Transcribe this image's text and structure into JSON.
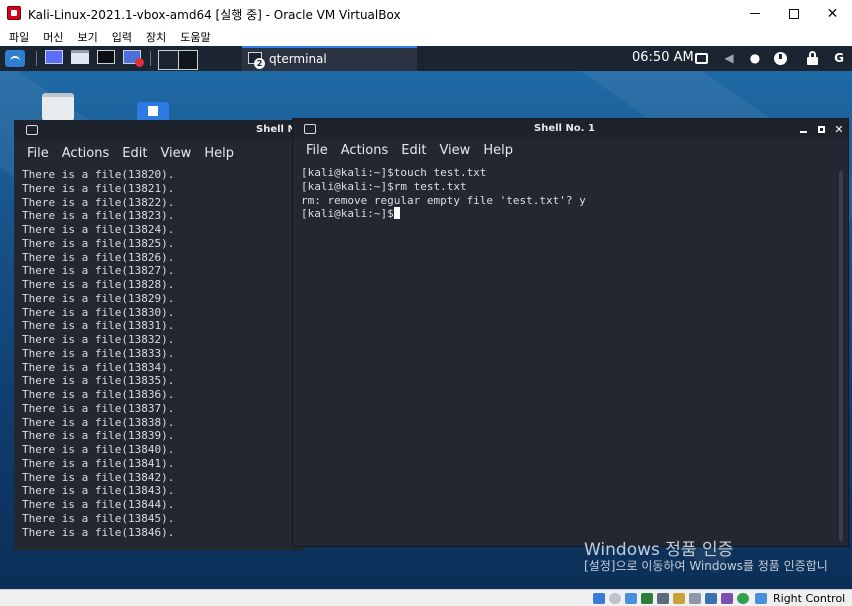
{
  "window": {
    "title": "Kali-Linux-2021.1-vbox-amd64 [실행 중] - Oracle VM VirtualBox",
    "icon": "virtualbox-icon",
    "controls": [
      "minimize",
      "maximize",
      "close"
    ]
  },
  "vbox_menu": [
    "파일",
    "머신",
    "보기",
    "입력",
    "장치",
    "도움말"
  ],
  "kali_panel": {
    "taskbar_item": "qterminal",
    "taskbar_badge": "2",
    "clock": "06:50 AM",
    "tray_icons": [
      "display-icon",
      "volume-icon",
      "notification-bell-icon",
      "power-icon",
      "lock-icon",
      "logout-icon"
    ]
  },
  "terminal_back": {
    "title": "Shell No",
    "menu": [
      "File",
      "Actions",
      "Edit",
      "View",
      "Help"
    ],
    "lines": [
      "There is a file(13820).",
      "There is a file(13821).",
      "There is a file(13822).",
      "There is a file(13823).",
      "There is a file(13824).",
      "There is a file(13825).",
      "There is a file(13826).",
      "There is a file(13827).",
      "There is a file(13828).",
      "There is a file(13829).",
      "There is a file(13830).",
      "There is a file(13831).",
      "There is a file(13832).",
      "There is a file(13833).",
      "There is a file(13834).",
      "There is a file(13835).",
      "There is a file(13836).",
      "There is a file(13837).",
      "There is a file(13838).",
      "There is a file(13839).",
      "There is a file(13840).",
      "There is a file(13841).",
      "There is a file(13842).",
      "There is a file(13843).",
      "There is a file(13844).",
      "There is a file(13845).",
      "There is a file(13846)."
    ]
  },
  "terminal_front": {
    "title": "Shell No. 1",
    "menu": [
      "File",
      "Actions",
      "Edit",
      "View",
      "Help"
    ],
    "lines": [
      "[kali@kali:~]$touch test.txt",
      "[kali@kali:~]$rm test.txt",
      "rm: remove regular empty file 'test.txt'? y"
    ],
    "prompt": "[kali@kali:~]$"
  },
  "activation": {
    "title": "Windows 정품 인증",
    "subtitle": "[설정]으로 이동하여 Windows를 정품 인증합니"
  },
  "status_bar": {
    "host_key": "Right Control"
  }
}
